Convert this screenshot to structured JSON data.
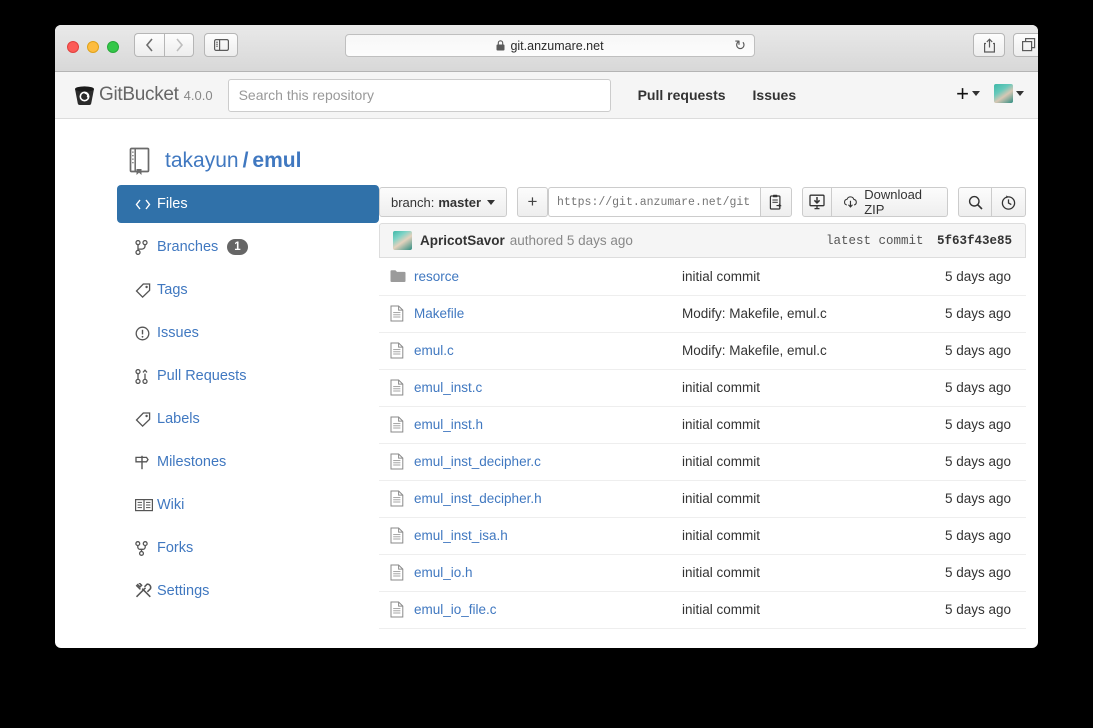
{
  "browser": {
    "url": "git.anzumare.net",
    "lock_icon": "lock-icon",
    "reload_icon": "reload-icon",
    "back_icon": "chevron-left-icon",
    "forward_icon": "chevron-right-icon",
    "sidebar_icon": "sidebar-panel-icon",
    "share_icon": "share-icon",
    "tabs_icon": "tabs-overview-icon",
    "newtab_label": "+"
  },
  "header": {
    "logo_icon": "gitbucket-bucket-icon",
    "product_name": "GitBucket",
    "version": "4.0.0",
    "search_placeholder": "Search this repository",
    "search_value": "",
    "nav": [
      {
        "label": "Pull requests"
      },
      {
        "label": "Issues"
      }
    ],
    "create_menu_label": "+",
    "avatar_name": "user-avatar"
  },
  "repo": {
    "icon": "repository-book-icon",
    "owner": "takayun",
    "separator": "/",
    "name": "emul"
  },
  "sidebar": {
    "items": [
      {
        "label": "Files",
        "icon": "code-brackets-icon",
        "active": true,
        "badge": null
      },
      {
        "label": "Branches",
        "icon": "branch-icon",
        "active": false,
        "badge": "1"
      },
      {
        "label": "Tags",
        "icon": "tag-icon",
        "active": false,
        "badge": null
      },
      {
        "label": "Issues",
        "icon": "issue-circle-icon",
        "active": false,
        "badge": null
      },
      {
        "label": "Pull Requests",
        "icon": "pull-request-icon",
        "active": false,
        "badge": null
      },
      {
        "label": "Labels",
        "icon": "tag-icon",
        "active": false,
        "badge": null
      },
      {
        "label": "Milestones",
        "icon": "milestone-icon",
        "active": false,
        "badge": null
      },
      {
        "label": "Wiki",
        "icon": "book-open-icon",
        "active": false,
        "badge": null
      },
      {
        "label": "Forks",
        "icon": "fork-icon",
        "active": false,
        "badge": null
      },
      {
        "label": "Settings",
        "icon": "tools-icon",
        "active": false,
        "badge": null
      }
    ]
  },
  "toolbar": {
    "branch_prefix": "branch:",
    "branch_name": "master",
    "add_file_label": "+",
    "clone_url_placeholder": "https://git.anzumare.net/git.",
    "clone_url_value": "",
    "copy_icon": "clipboard-copy-icon",
    "download_desktop_icon": "download-to-desktop-icon",
    "download_zip_label": "Download ZIP",
    "download_zip_icon": "cloud-download-icon",
    "search_icon": "search-icon",
    "history_icon": "history-clock-icon"
  },
  "latest_commit": {
    "avatar_name": "commit-author-avatar",
    "author": "ApricotSavor",
    "meta": "authored 5 days ago",
    "hash_label": "latest commit",
    "hash": "5f63f43e85"
  },
  "files": [
    {
      "name": "resorce",
      "type": "dir",
      "message": "initial commit",
      "time": "5 days ago"
    },
    {
      "name": "Makefile",
      "type": "file",
      "message": "Modify: Makefile, emul.c",
      "time": "5 days ago"
    },
    {
      "name": "emul.c",
      "type": "file",
      "message": "Modify: Makefile, emul.c",
      "time": "5 days ago"
    },
    {
      "name": "emul_inst.c",
      "type": "file",
      "message": "initial commit",
      "time": "5 days ago"
    },
    {
      "name": "emul_inst.h",
      "type": "file",
      "message": "initial commit",
      "time": "5 days ago"
    },
    {
      "name": "emul_inst_decipher.c",
      "type": "file",
      "message": "initial commit",
      "time": "5 days ago"
    },
    {
      "name": "emul_inst_decipher.h",
      "type": "file",
      "message": "initial commit",
      "time": "5 days ago"
    },
    {
      "name": "emul_inst_isa.h",
      "type": "file",
      "message": "initial commit",
      "time": "5 days ago"
    },
    {
      "name": "emul_io.h",
      "type": "file",
      "message": "initial commit",
      "time": "5 days ago"
    },
    {
      "name": "emul_io_file.c",
      "type": "file",
      "message": "initial commit",
      "time": "5 days ago"
    }
  ],
  "colors": {
    "link": "#4078c0",
    "active_sidebar": "#3071a9",
    "page_bg": "#ffffff",
    "header_bg": "#f5f5f5",
    "desktop_bg": "#000000"
  }
}
